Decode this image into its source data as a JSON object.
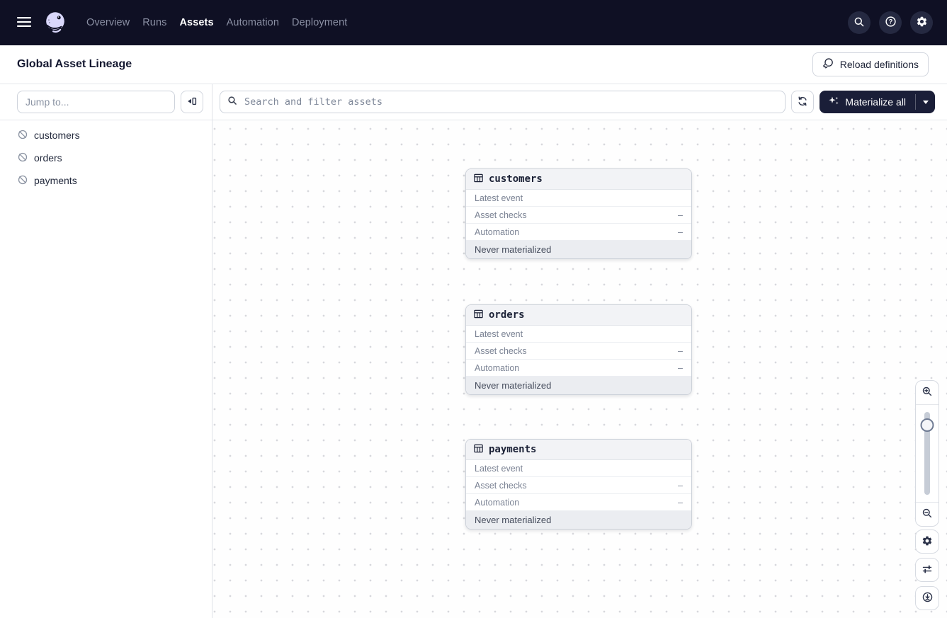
{
  "nav": {
    "items": [
      {
        "label": "Overview"
      },
      {
        "label": "Runs"
      },
      {
        "label": "Assets"
      },
      {
        "label": "Automation"
      },
      {
        "label": "Deployment"
      }
    ]
  },
  "header": {
    "title": "Global Asset Lineage",
    "reload_label": "Reload definitions"
  },
  "sidebar": {
    "jump_placeholder": "Jump to...",
    "assets": [
      {
        "name": "customers"
      },
      {
        "name": "orders"
      },
      {
        "name": "payments"
      }
    ]
  },
  "toolbar": {
    "search_placeholder": "Search and filter assets",
    "materialize_label": "Materialize all"
  },
  "graph": {
    "nodes": [
      {
        "name": "customers",
        "rows": [
          {
            "label": "Latest event",
            "value": ""
          },
          {
            "label": "Asset checks",
            "value": "–"
          },
          {
            "label": "Automation",
            "value": "–"
          }
        ],
        "status": "Never materialized"
      },
      {
        "name": "orders",
        "rows": [
          {
            "label": "Latest event",
            "value": ""
          },
          {
            "label": "Asset checks",
            "value": "–"
          },
          {
            "label": "Automation",
            "value": "–"
          }
        ],
        "status": "Never materialized"
      },
      {
        "name": "payments",
        "rows": [
          {
            "label": "Latest event",
            "value": ""
          },
          {
            "label": "Asset checks",
            "value": "–"
          },
          {
            "label": "Automation",
            "value": "–"
          }
        ],
        "status": "Never materialized"
      }
    ]
  },
  "colors": {
    "nav_bg": "#0f1024",
    "logo_lavender": "#d9d7fb",
    "button_dark": "#1a1e38",
    "node_header_bg": "#f2f3f6",
    "node_footer_bg": "#ebedf1",
    "border": "#d2d6de",
    "muted_text": "#7b8394",
    "canvas_dot": "#d7d8dc"
  }
}
